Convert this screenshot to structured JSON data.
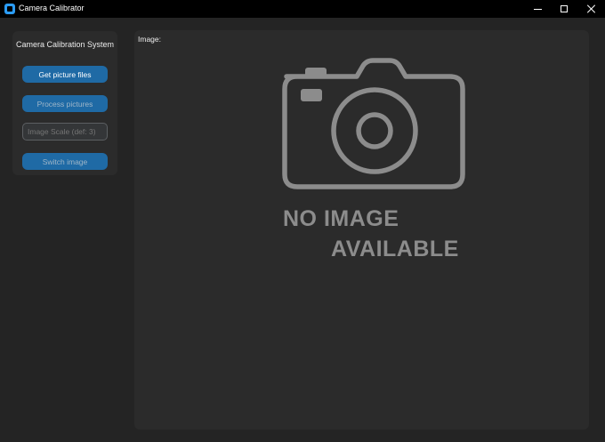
{
  "window": {
    "title": "Camera Calibrator",
    "accent_color": "#2b9cf5"
  },
  "sidebar": {
    "title": "Camera Calibration System",
    "get_files_label": "Get picture files",
    "process_label": "Process pictures",
    "scale_placeholder": "Image Scale (def: 3)",
    "switch_label": "Switch image"
  },
  "image_panel": {
    "label": "Image:",
    "placeholder_line1": "NO IMAGE",
    "placeholder_line2": "AVAILABLE",
    "placeholder_icon": "camera-icon"
  },
  "colors": {
    "button": "#1f6aa5",
    "panel": "#2b2b2b",
    "background": "#242424",
    "placeholder_gray": "#8c8c8c"
  }
}
